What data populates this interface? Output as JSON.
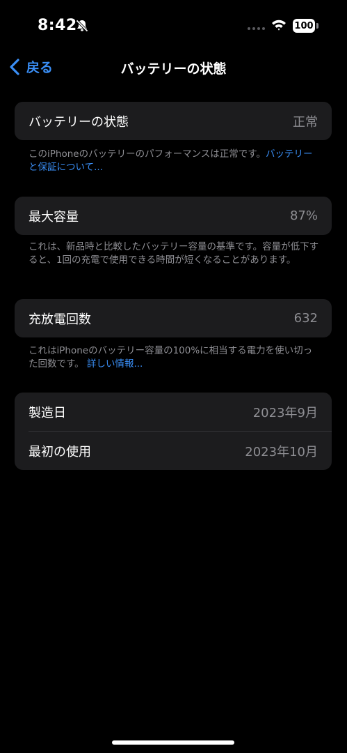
{
  "status_bar": {
    "time": "8:42",
    "battery_percent": "100"
  },
  "nav": {
    "back_label": "戻る",
    "title": "バッテリーの状態"
  },
  "battery_state": {
    "label": "バッテリーの状態",
    "value": "正常",
    "footnote": "このiPhoneのバッテリーのパフォーマンスは正常です。",
    "footnote_link": "バッテリーと保証について..."
  },
  "max_capacity": {
    "label": "最大容量",
    "value": "87%",
    "footnote": "これは、新品時と比較したバッテリー容量の基準です。容量が低下すると、1回の充電で使用できる時間が短くなることがあります。"
  },
  "cycle_count": {
    "label": "充放電回数",
    "value": "632",
    "footnote": "これはiPhoneのバッテリー容量の100%に相当する電力を使い切った回数です。",
    "footnote_link": "詳しい情報..."
  },
  "dates": {
    "manufacture_label": "製造日",
    "manufacture_value": "2023年9月",
    "first_use_label": "最初の使用",
    "first_use_value": "2023年10月"
  },
  "colors": {
    "background": "#000000",
    "card": "#1c1c1e",
    "accent": "#3a8ff7",
    "secondary_text": "#8e8e93"
  }
}
